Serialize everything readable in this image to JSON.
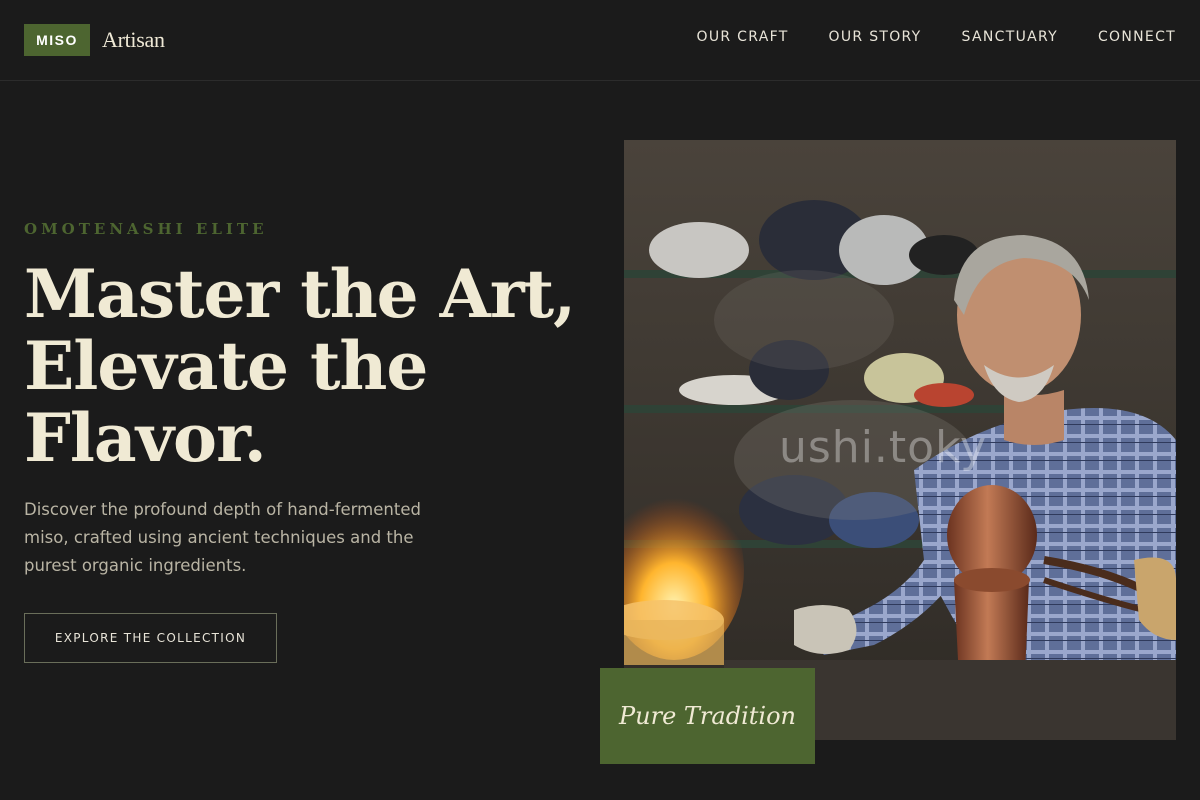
{
  "brand": {
    "badge": "MISO",
    "name": "Artisan",
    "accent_color": "#4d6530"
  },
  "nav": {
    "items": [
      {
        "label": "OUR CRAFT"
      },
      {
        "label": "OUR STORY"
      },
      {
        "label": "SANCTUARY"
      },
      {
        "label": "CONNECT"
      }
    ]
  },
  "hero": {
    "eyebrow": "OMOTENASHI ELITE",
    "headline_lines": [
      "Master the Art,",
      "Elevate the",
      "Flavor."
    ],
    "subtext": "Discover the profound depth of hand-fermented miso, crafted using ancient techniques and the purest organic ingredients.",
    "cta_label": "EXPLORE THE COLLECTION"
  },
  "image": {
    "watermark": "ushi.toky",
    "caption": "Pure Tradition"
  }
}
